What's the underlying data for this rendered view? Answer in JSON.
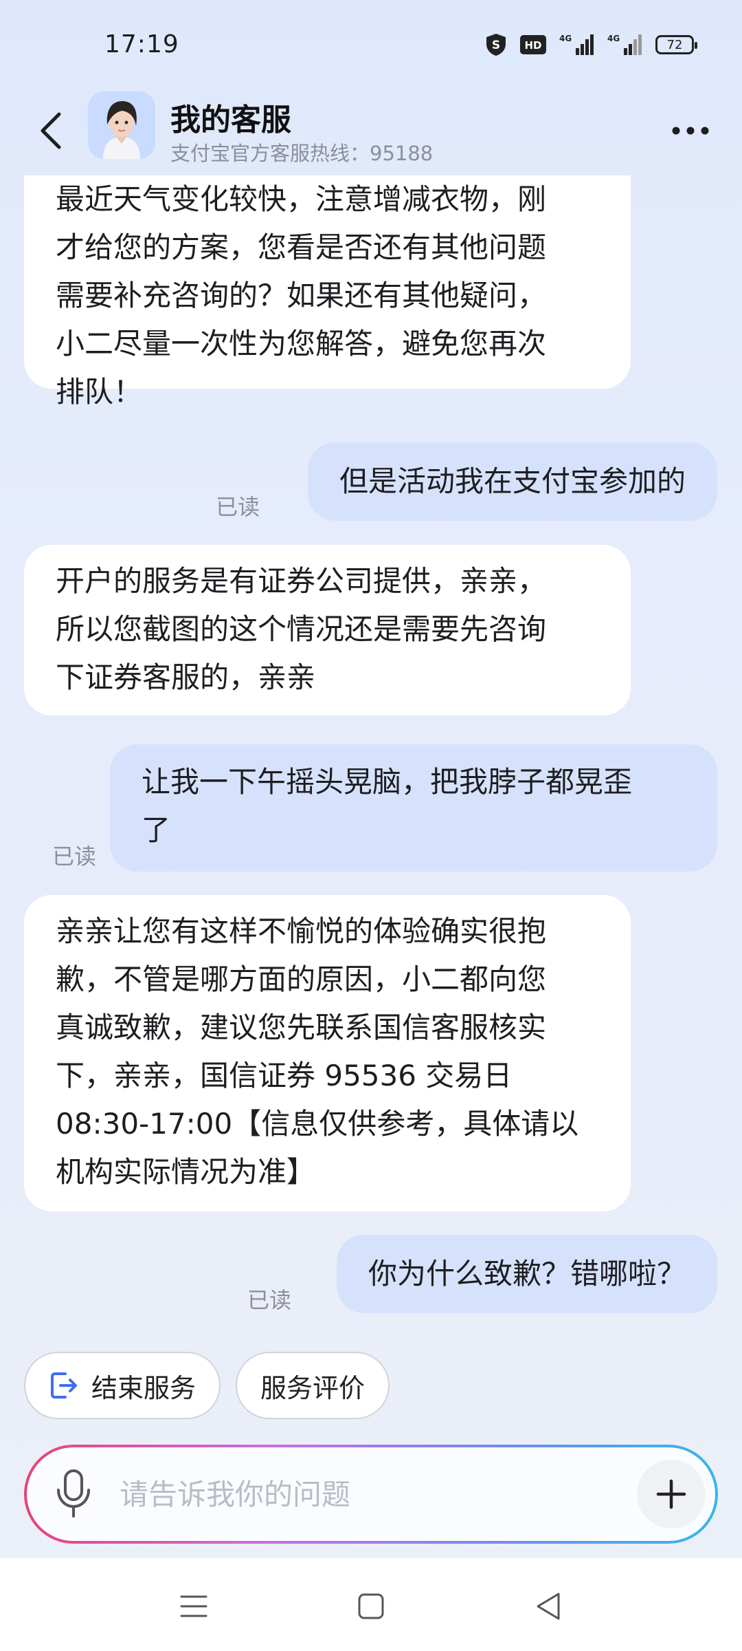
{
  "status_bar": {
    "time": "17:19",
    "signal_label": "4G",
    "battery": "72",
    "icons": [
      "shield-s-icon",
      "hd-icon",
      "signal-4g-icon",
      "signal-4g-icon",
      "battery-icon"
    ]
  },
  "header": {
    "title": "我的客服",
    "subtitle": "支付宝官方客服热线：95188"
  },
  "messages": [
    {
      "from": "agent",
      "lines": [
        "最近天气变化较快，注意增减衣物，刚",
        "才给您的方案，您看是否还有其他问题",
        "需要补充咨询的？如果还有其他疑问，",
        "小二尽量一次性为您解答，避免您再次",
        "排队！"
      ]
    },
    {
      "from": "user",
      "lines": [
        "但是活动我在支付宝参加的"
      ],
      "status": "已读"
    },
    {
      "from": "agent",
      "lines": [
        "开户的服务是有证券公司提供，亲亲，",
        "所以您截图的这个情况还是需要先咨询",
        "下证券客服的，亲亲"
      ]
    },
    {
      "from": "user",
      "lines": [
        "让我一下午摇头晃脑，把我脖子都晃歪",
        "了"
      ],
      "status": "已读"
    },
    {
      "from": "agent",
      "lines": [
        "亲亲让您有这样不愉悦的体验确实很抱",
        "歉，不管是哪方面的原因，小二都向您",
        "真诚致歉，建议您先联系国信客服核实",
        "下，亲亲，国信证券 95536 交易日",
        "08:30-17:00【信息仅供参考，具体请以",
        "机构实际情况为准】"
      ]
    },
    {
      "from": "user",
      "lines": [
        "你为什么致歉？错哪啦？"
      ],
      "status": "已读"
    }
  ],
  "quick_actions": {
    "end_service": "结束服务",
    "rate_service": "服务评价"
  },
  "input": {
    "placeholder": "请告诉我你的问题",
    "value": ""
  },
  "colors": {
    "user_bubble": "#d6e2fb",
    "agent_bubble": "#ffffff",
    "accent": "#3d6ff0"
  }
}
